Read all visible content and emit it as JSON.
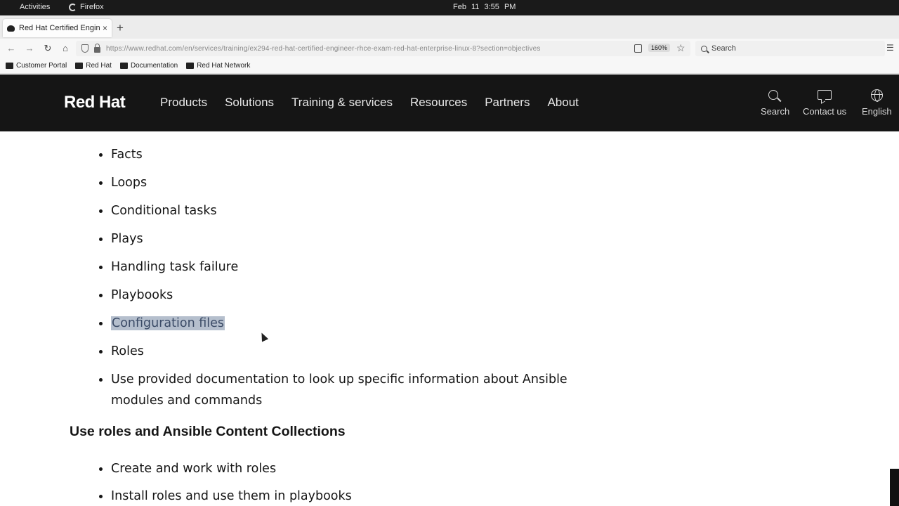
{
  "system_bar": {
    "activities": "Activities",
    "app_name": "Firefox",
    "clock": "Feb 11  3:55 PM"
  },
  "browser": {
    "tab_title": "Red Hat Certified Engineer",
    "tab_close": "×",
    "new_tab": "+",
    "url_host": "https://www.redhat.com",
    "url_path": "/en/services/training/ex294-red-hat-certified-engineer-rhce-exam-red-hat-enterprise-linux-8?section=objectives",
    "zoom": "160%",
    "search_placeholder": "Search",
    "bookmarks": [
      "Customer Portal",
      "Red Hat",
      "Documentation",
      "Red Hat Network"
    ]
  },
  "masthead": {
    "logo": "Red Hat",
    "nav": [
      "Products",
      "Solutions",
      "Training & services",
      "Resources",
      "Partners",
      "About"
    ],
    "utility": {
      "search": "Search",
      "contact": "Contact us",
      "language": "English"
    }
  },
  "content": {
    "objectives": [
      "Facts",
      "Loops",
      "Conditional tasks",
      "Plays",
      "Handling task failure",
      "Playbooks",
      "Configuration files",
      "Roles",
      "Use provided documentation to look up specific information about Ansible modules and commands"
    ],
    "highlighted_index": 6,
    "section_heading": "Use roles and Ansible Content Collections",
    "section_items": [
      "Create and work with roles",
      "Install roles and use them in playbooks"
    ]
  },
  "colors": {
    "masthead_bg": "#151515",
    "highlight": "#b5bfcd"
  }
}
